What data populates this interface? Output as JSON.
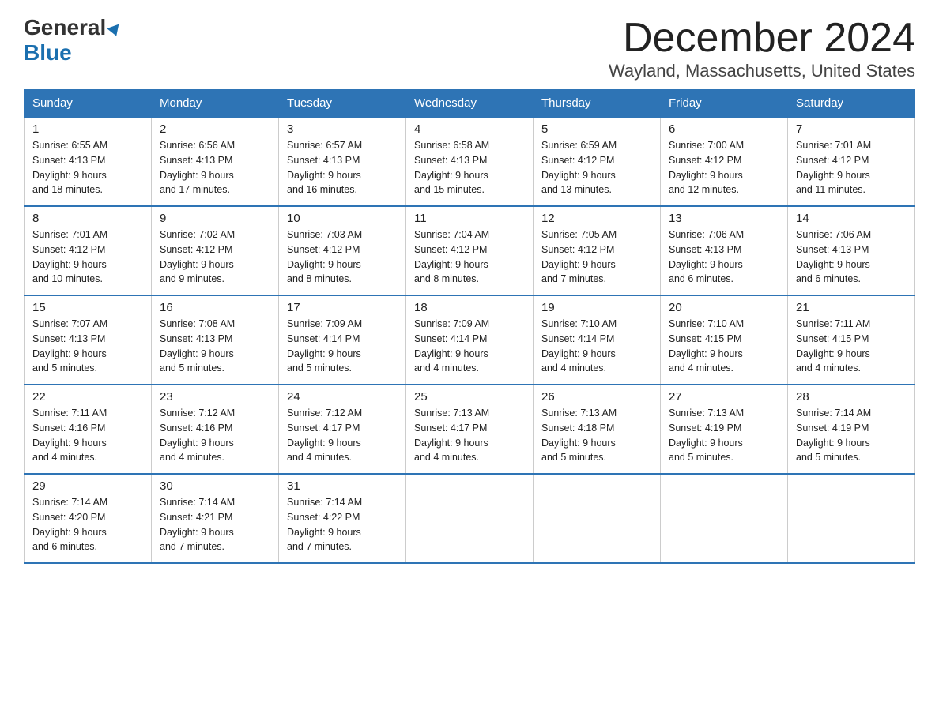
{
  "header": {
    "logo_line1": "General",
    "logo_line2": "Blue",
    "title": "December 2024",
    "subtitle": "Wayland, Massachusetts, United States"
  },
  "days_of_week": [
    "Sunday",
    "Monday",
    "Tuesday",
    "Wednesday",
    "Thursday",
    "Friday",
    "Saturday"
  ],
  "weeks": [
    {
      "days": [
        {
          "num": "1",
          "sunrise": "6:55 AM",
          "sunset": "4:13 PM",
          "daylight": "9 hours and 18 minutes."
        },
        {
          "num": "2",
          "sunrise": "6:56 AM",
          "sunset": "4:13 PM",
          "daylight": "9 hours and 17 minutes."
        },
        {
          "num": "3",
          "sunrise": "6:57 AM",
          "sunset": "4:13 PM",
          "daylight": "9 hours and 16 minutes."
        },
        {
          "num": "4",
          "sunrise": "6:58 AM",
          "sunset": "4:13 PM",
          "daylight": "9 hours and 15 minutes."
        },
        {
          "num": "5",
          "sunrise": "6:59 AM",
          "sunset": "4:12 PM",
          "daylight": "9 hours and 13 minutes."
        },
        {
          "num": "6",
          "sunrise": "7:00 AM",
          "sunset": "4:12 PM",
          "daylight": "9 hours and 12 minutes."
        },
        {
          "num": "7",
          "sunrise": "7:01 AM",
          "sunset": "4:12 PM",
          "daylight": "9 hours and 11 minutes."
        }
      ]
    },
    {
      "days": [
        {
          "num": "8",
          "sunrise": "7:01 AM",
          "sunset": "4:12 PM",
          "daylight": "9 hours and 10 minutes."
        },
        {
          "num": "9",
          "sunrise": "7:02 AM",
          "sunset": "4:12 PM",
          "daylight": "9 hours and 9 minutes."
        },
        {
          "num": "10",
          "sunrise": "7:03 AM",
          "sunset": "4:12 PM",
          "daylight": "9 hours and 8 minutes."
        },
        {
          "num": "11",
          "sunrise": "7:04 AM",
          "sunset": "4:12 PM",
          "daylight": "9 hours and 8 minutes."
        },
        {
          "num": "12",
          "sunrise": "7:05 AM",
          "sunset": "4:12 PM",
          "daylight": "9 hours and 7 minutes."
        },
        {
          "num": "13",
          "sunrise": "7:06 AM",
          "sunset": "4:13 PM",
          "daylight": "9 hours and 6 minutes."
        },
        {
          "num": "14",
          "sunrise": "7:06 AM",
          "sunset": "4:13 PM",
          "daylight": "9 hours and 6 minutes."
        }
      ]
    },
    {
      "days": [
        {
          "num": "15",
          "sunrise": "7:07 AM",
          "sunset": "4:13 PM",
          "daylight": "9 hours and 5 minutes."
        },
        {
          "num": "16",
          "sunrise": "7:08 AM",
          "sunset": "4:13 PM",
          "daylight": "9 hours and 5 minutes."
        },
        {
          "num": "17",
          "sunrise": "7:09 AM",
          "sunset": "4:14 PM",
          "daylight": "9 hours and 5 minutes."
        },
        {
          "num": "18",
          "sunrise": "7:09 AM",
          "sunset": "4:14 PM",
          "daylight": "9 hours and 4 minutes."
        },
        {
          "num": "19",
          "sunrise": "7:10 AM",
          "sunset": "4:14 PM",
          "daylight": "9 hours and 4 minutes."
        },
        {
          "num": "20",
          "sunrise": "7:10 AM",
          "sunset": "4:15 PM",
          "daylight": "9 hours and 4 minutes."
        },
        {
          "num": "21",
          "sunrise": "7:11 AM",
          "sunset": "4:15 PM",
          "daylight": "9 hours and 4 minutes."
        }
      ]
    },
    {
      "days": [
        {
          "num": "22",
          "sunrise": "7:11 AM",
          "sunset": "4:16 PM",
          "daylight": "9 hours and 4 minutes."
        },
        {
          "num": "23",
          "sunrise": "7:12 AM",
          "sunset": "4:16 PM",
          "daylight": "9 hours and 4 minutes."
        },
        {
          "num": "24",
          "sunrise": "7:12 AM",
          "sunset": "4:17 PM",
          "daylight": "9 hours and 4 minutes."
        },
        {
          "num": "25",
          "sunrise": "7:13 AM",
          "sunset": "4:17 PM",
          "daylight": "9 hours and 4 minutes."
        },
        {
          "num": "26",
          "sunrise": "7:13 AM",
          "sunset": "4:18 PM",
          "daylight": "9 hours and 5 minutes."
        },
        {
          "num": "27",
          "sunrise": "7:13 AM",
          "sunset": "4:19 PM",
          "daylight": "9 hours and 5 minutes."
        },
        {
          "num": "28",
          "sunrise": "7:14 AM",
          "sunset": "4:19 PM",
          "daylight": "9 hours and 5 minutes."
        }
      ]
    },
    {
      "days": [
        {
          "num": "29",
          "sunrise": "7:14 AM",
          "sunset": "4:20 PM",
          "daylight": "9 hours and 6 minutes."
        },
        {
          "num": "30",
          "sunrise": "7:14 AM",
          "sunset": "4:21 PM",
          "daylight": "9 hours and 7 minutes."
        },
        {
          "num": "31",
          "sunrise": "7:14 AM",
          "sunset": "4:22 PM",
          "daylight": "9 hours and 7 minutes."
        },
        null,
        null,
        null,
        null
      ]
    }
  ],
  "labels": {
    "sunrise": "Sunrise:",
    "sunset": "Sunset:",
    "daylight": "Daylight:"
  }
}
